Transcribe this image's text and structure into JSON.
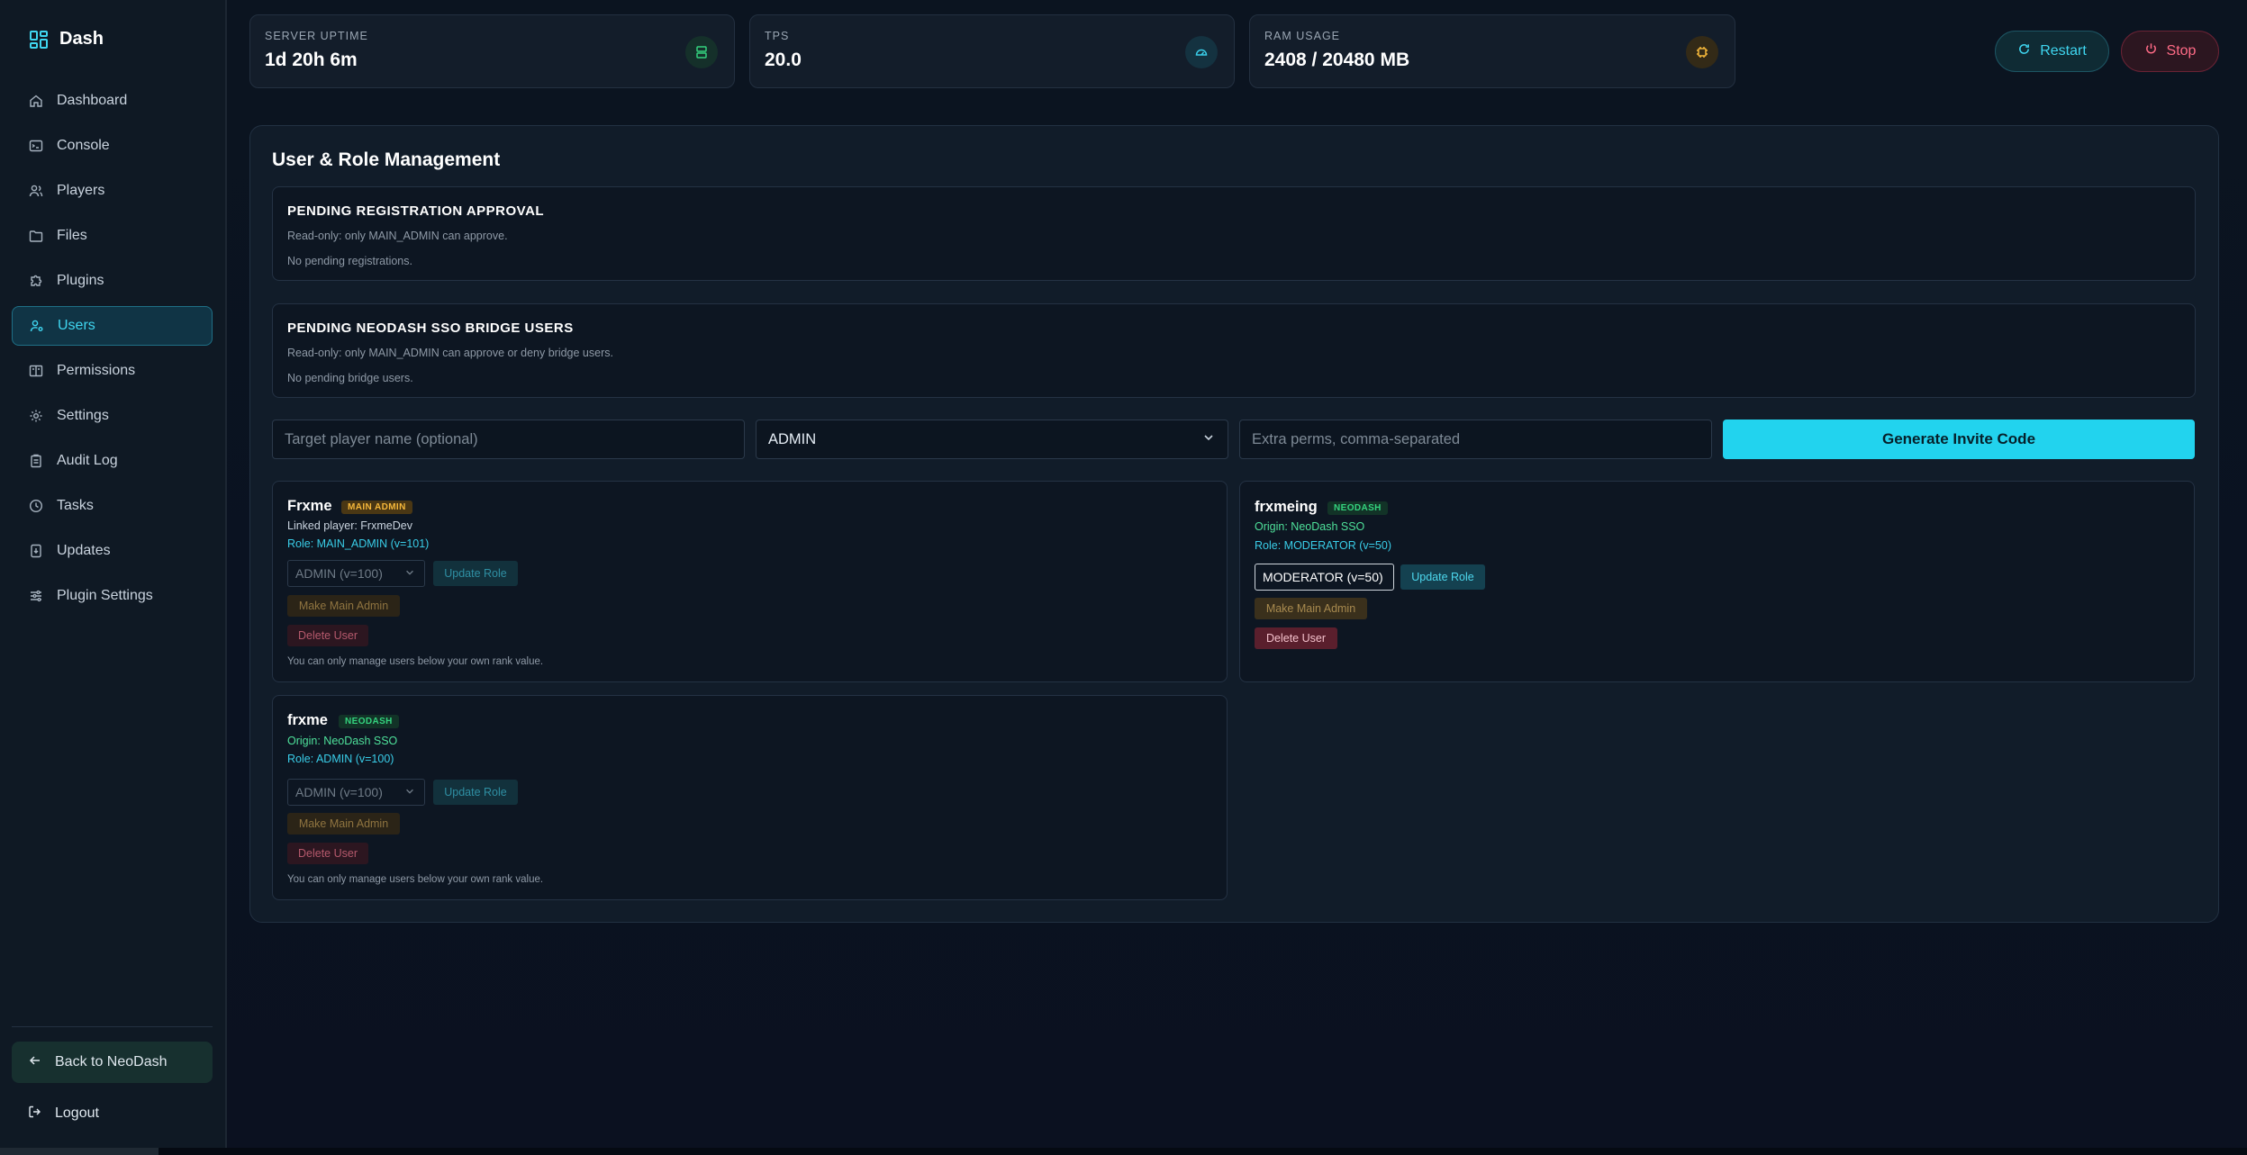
{
  "app": {
    "name": "Dash"
  },
  "sidebar": {
    "items": [
      {
        "label": "Dashboard",
        "icon": "home-icon"
      },
      {
        "label": "Console",
        "icon": "terminal-icon"
      },
      {
        "label": "Players",
        "icon": "users-icon"
      },
      {
        "label": "Files",
        "icon": "folder-icon"
      },
      {
        "label": "Plugins",
        "icon": "puzzle-icon"
      },
      {
        "label": "Users",
        "icon": "user-cog-icon",
        "active": true
      },
      {
        "label": "Permissions",
        "icon": "book-icon"
      },
      {
        "label": "Settings",
        "icon": "gear-icon"
      },
      {
        "label": "Audit Log",
        "icon": "clipboard-icon"
      },
      {
        "label": "Tasks",
        "icon": "clock-icon"
      },
      {
        "label": "Updates",
        "icon": "download-icon"
      },
      {
        "label": "Plugin Settings",
        "icon": "sliders-icon"
      }
    ],
    "back_label": "Back to NeoDash",
    "logout_label": "Logout"
  },
  "stats": [
    {
      "label": "SERVER UPTIME",
      "value": "1d 20h 6m",
      "icon": "server-icon",
      "accent": "#34d37e"
    },
    {
      "label": "TPS",
      "value": "20.0",
      "icon": "gauge-icon",
      "accent": "#39cde8"
    },
    {
      "label": "RAM USAGE",
      "value": "2408 / 20480 MB",
      "icon": "cpu-icon",
      "accent": "#f5b73a"
    }
  ],
  "toolbar": {
    "restart_label": "Restart",
    "stop_label": "Stop"
  },
  "main": {
    "title": "User & Role Management",
    "pending_registration": {
      "heading": "PENDING REGISTRATION APPROVAL",
      "subtext": "Read-only: only MAIN_ADMIN can approve.",
      "empty_text": "No pending registrations."
    },
    "pending_sso": {
      "heading": "PENDING NEODASH SSO BRIDGE USERS",
      "subtext": "Read-only: only MAIN_ADMIN can approve or deny bridge users.",
      "empty_text": "No pending bridge users."
    },
    "invite": {
      "target_placeholder": "Target player name (optional)",
      "role_value": "ADMIN",
      "perms_placeholder": "Extra perms, comma-separated",
      "generate_label": "Generate Invite Code"
    },
    "users": [
      {
        "name": "Frxme",
        "tag": "MAIN ADMIN",
        "line1": "Linked player: FrxmeDev",
        "role": "Role: MAIN_ADMIN (v=101)",
        "select_value": "ADMIN (v=100)",
        "update_label": "Update Role",
        "make_admin_label": "Make Main Admin",
        "delete_label": "Delete User",
        "note": "You can only manage users below your own rank value."
      },
      {
        "name": "frxmeing",
        "tag": "NEODASH",
        "line1": "Origin: NeoDash SSO",
        "role": "Role: MODERATOR (v=50)",
        "select_value": "MODERATOR (v=50)",
        "update_label": "Update Role",
        "make_admin_label": "Make Main Admin",
        "delete_label": "Delete User"
      },
      {
        "name": "frxme",
        "tag": "NEODASH",
        "line1": "Origin: NeoDash SSO",
        "role": "Role: ADMIN (v=100)",
        "select_value": "ADMIN (v=100)",
        "update_label": "Update Role",
        "make_admin_label": "Make Main Admin",
        "delete_label": "Delete User",
        "note": "You can only manage users below your own rank value."
      }
    ]
  }
}
